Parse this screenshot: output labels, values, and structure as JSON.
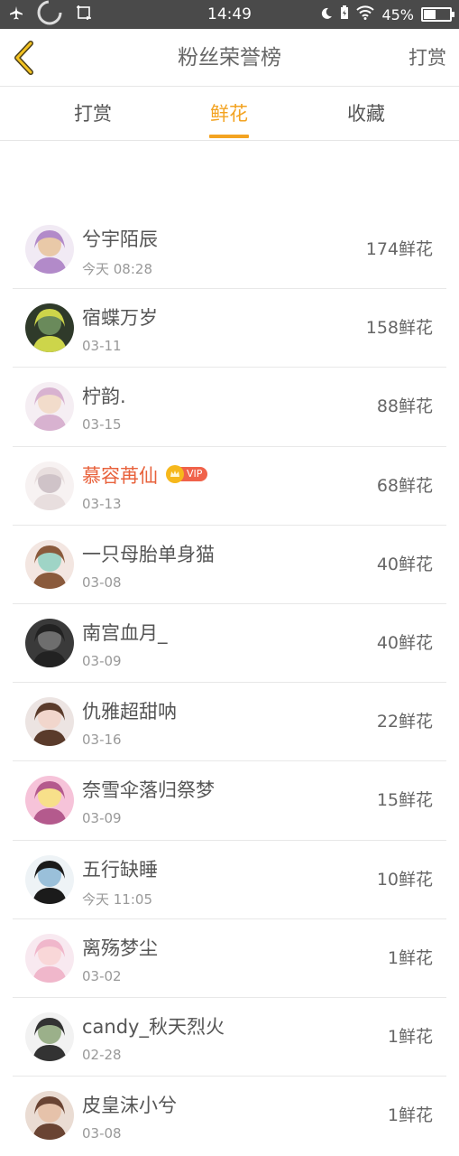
{
  "status_bar": {
    "time": "14:49",
    "battery_percent": "45%",
    "battery_level": 0.45,
    "icons": [
      "airplane-icon",
      "loading-icon",
      "screenshot-icon",
      "moon-icon",
      "battery-saver-icon",
      "wifi-icon",
      "battery-icon"
    ]
  },
  "header": {
    "back_icon": "chevron-left-icon",
    "title": "粉丝荣誉榜",
    "right_action": "打赏"
  },
  "tabs": [
    {
      "label": "打赏",
      "active": false
    },
    {
      "label": "鲜花",
      "active": true
    },
    {
      "label": "收藏",
      "active": false
    }
  ],
  "colors": {
    "accent": "#f3a321",
    "vip_name": "#e8623c",
    "status_bar_bg": "#4a4a4a"
  },
  "fans": [
    {
      "name": "兮宇陌辰",
      "date": "今天 08:28",
      "score": "174鲜花",
      "vip": false
    },
    {
      "name": "宿蝶万岁",
      "date": "03-11",
      "score": "158鲜花",
      "vip": false
    },
    {
      "name": "柠韵.",
      "date": "03-15",
      "score": "88鲜花",
      "vip": false
    },
    {
      "name": "慕容苒仙",
      "date": "03-13",
      "score": "68鲜花",
      "vip": true,
      "vip_label": "VIP"
    },
    {
      "name": "一只母胎单身猫",
      "date": "03-08",
      "score": "40鲜花",
      "vip": false
    },
    {
      "name": "南宫血月_",
      "date": "03-09",
      "score": "40鲜花",
      "vip": false
    },
    {
      "name": "仇雅超甜呐",
      "date": "03-16",
      "score": "22鲜花",
      "vip": false
    },
    {
      "name": "奈雪伞落归祭梦",
      "date": "03-09",
      "score": "15鲜花",
      "vip": false
    },
    {
      "name": "五行缺睡",
      "date": "今天 11:05",
      "score": "10鲜花",
      "vip": false
    },
    {
      "name": "离殇梦尘",
      "date": "03-02",
      "score": "1鲜花",
      "vip": false
    },
    {
      "name": "candy_秋天烈火",
      "date": "02-28",
      "score": "1鲜花",
      "vip": false
    },
    {
      "name": "皮皇沫小兮",
      "date": "03-08",
      "score": "1鲜花",
      "vip": false
    }
  ]
}
